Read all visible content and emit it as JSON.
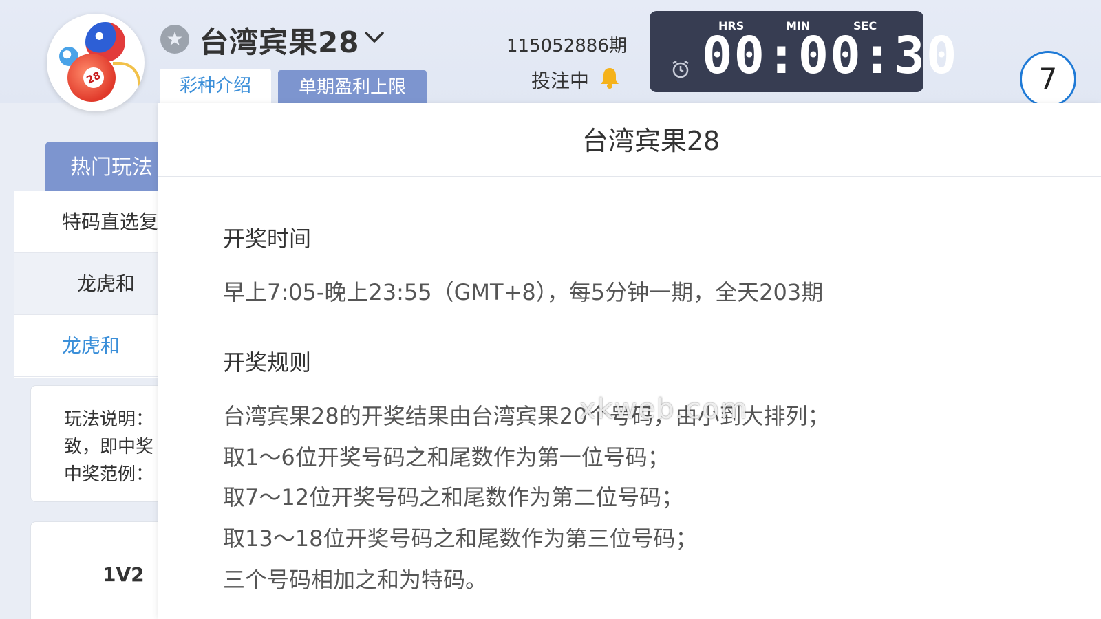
{
  "header": {
    "game_title": "台湾宾果28",
    "tabs": [
      {
        "label": "彩种介绍",
        "active": true
      },
      {
        "label": "单期盈利上限",
        "active": false
      }
    ],
    "period": "115052886期",
    "bet_status": "投注中",
    "badge_value": "7"
  },
  "logo": {
    "ball_number": "28"
  },
  "timer": {
    "hrs_label": "HRS",
    "min_label": "MIN",
    "sec_label": "SEC",
    "display": "00:00:30"
  },
  "sidebar": {
    "hot_tab": "热门玩法",
    "items": [
      {
        "label": "特码直选复"
      },
      {
        "label": "龙虎和"
      },
      {
        "label": "龙虎和"
      }
    ],
    "info_lines": [
      "玩法说明：",
      "致，即中奖",
      "中奖范例："
    ],
    "odds_label": "1V2"
  },
  "modal": {
    "title": "台湾宾果28",
    "draw_time_heading": "开奖时间",
    "draw_time_text": "早上7:05-晚上23:55（GMT+8），每5分钟一期，全天203期",
    "draw_rules_heading": "开奖规则",
    "rules": [
      "台湾宾果28的开奖结果由台湾宾果20个号码，由小到大排列；",
      "取1～6位开奖号码之和尾数作为第一位号码；",
      "取7～12位开奖号码之和尾数作为第二位号码；",
      "取13～18位开奖号码之和尾数作为第三位号码；",
      "三个号码相加之和为特码。"
    ],
    "watermark": "xkweb.com"
  },
  "colors": {
    "accent_blue": "#3b8fd9",
    "tab_inactive": "#7d95cf",
    "timer_bg": "#373d52",
    "badge_border": "#1f7ad6"
  }
}
